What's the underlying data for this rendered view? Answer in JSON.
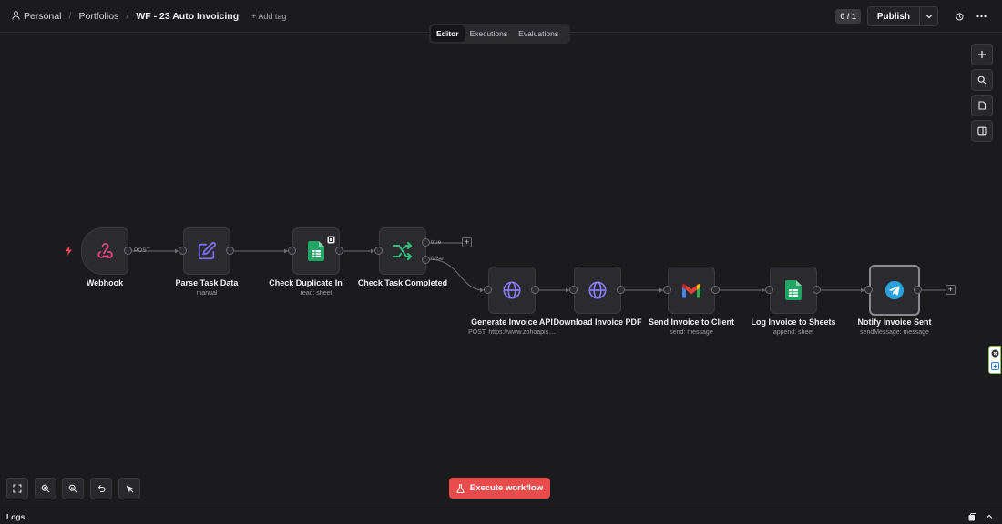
{
  "header": {
    "breadcrumbs": [
      "Personal",
      "Portfolios",
      "WF - 23 Auto Invoicing"
    ],
    "add_tag": "+ Add tag",
    "counter": "0 / 1",
    "publish": "Publish"
  },
  "tabs": [
    "Editor",
    "Executions",
    "Evaluations"
  ],
  "nodes": [
    {
      "label": "Webhook",
      "sub": "",
      "icon": "webhook-icon"
    },
    {
      "label": "Parse Task Data",
      "sub": "manual",
      "icon": "edit-icon"
    },
    {
      "label": "Check Duplicate Invoice",
      "sub": "read: sheet",
      "icon": "google-sheets-icon"
    },
    {
      "label": "Check Task Completed",
      "sub": "",
      "icon": "if-branch-icon"
    },
    {
      "label": "Generate Invoice API",
      "sub": "POST: https://www.zohoapis....",
      "icon": "globe-icon"
    },
    {
      "label": "Download Invoice PDF",
      "sub": "",
      "icon": "globe-icon"
    },
    {
      "label": "Send Invoice to Client",
      "sub": "send: message",
      "icon": "gmail-icon"
    },
    {
      "label": "Log Invoice to Sheets",
      "sub": "append: sheet",
      "icon": "google-sheets-icon"
    },
    {
      "label": "Notify Invoice Sent",
      "sub": "sendMessage: message",
      "icon": "telegram-icon"
    }
  ],
  "edge_labels": {
    "post": "POST",
    "true": "true",
    "false": "false"
  },
  "execute": "Execute workflow",
  "logs": "Logs",
  "colors": {
    "accent": "#ea4b4b",
    "webhook": "#e0457b",
    "edit": "#7b6ef6",
    "sheets": "#21a464",
    "branch": "#2ec27e",
    "globe": "#8b7cf6",
    "telegram": "#2aa1da"
  }
}
